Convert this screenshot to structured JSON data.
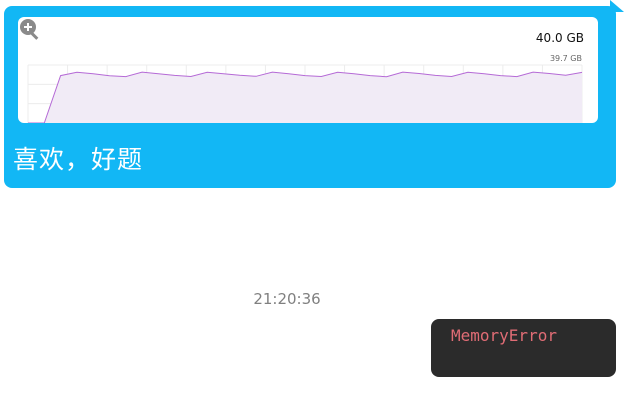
{
  "message_chart": {
    "max_label": "40.0 GB",
    "current_label": "39.7 GB",
    "zoom_icon": "zoom-in-icon",
    "chart_data": {
      "type": "area",
      "ylim": [
        0,
        40.0
      ],
      "values": [
        0,
        0,
        37.2,
        39.8,
        38.6,
        37.1,
        36.4,
        39.9,
        38.7,
        37.3,
        36.5,
        39.8,
        38.6,
        37.4,
        36.6,
        39.9,
        38.7,
        37.2,
        36.5,
        39.8,
        38.6,
        37.2,
        36.3,
        39.9,
        38.8,
        37.3,
        36.5,
        39.8,
        38.6,
        37.2,
        36.4,
        39.9,
        38.8,
        37.4,
        39.7
      ],
      "color": "#b56ad6",
      "fill": "#f1ebf6"
    }
  },
  "message_text": "喜欢，好题",
  "timestamp": "21:20:36",
  "code_message": "MemoryError",
  "colors": {
    "bubble": "#12b7f5",
    "code_bg": "#2b2b2b",
    "code_text": "#e06c75"
  }
}
